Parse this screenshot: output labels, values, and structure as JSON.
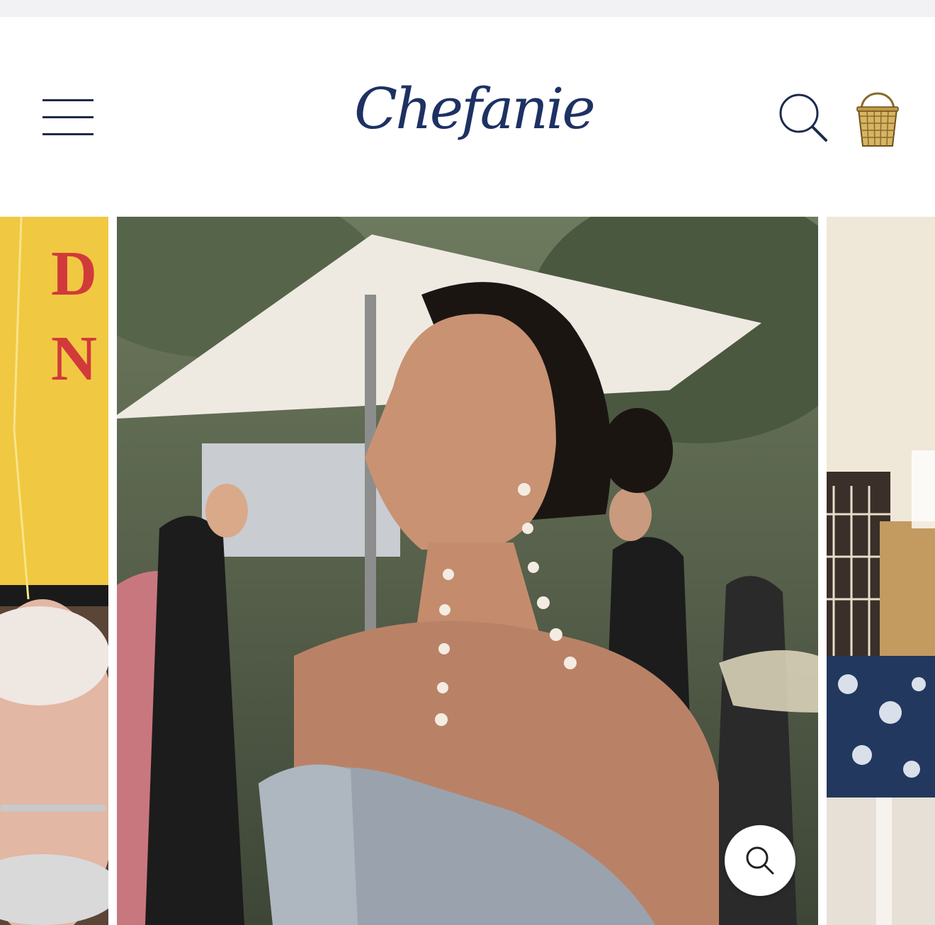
{
  "header": {
    "logo_text": "Chefanie",
    "menu_icon": "hamburger-menu-icon",
    "search_icon": "search-icon",
    "cart_icon": "basket-icon"
  },
  "gallery": {
    "slides": [
      {
        "position": "previous",
        "description_icon": "image"
      },
      {
        "position": "current",
        "description_icon": "image"
      },
      {
        "position": "next",
        "description_icon": "image"
      }
    ],
    "zoom_icon": "zoom-search-icon"
  },
  "colors": {
    "brand_navy": "#1d3163",
    "icon_navy": "#1d2a4d",
    "background": "#ffffff",
    "status_strip": "#f2f2f4"
  }
}
